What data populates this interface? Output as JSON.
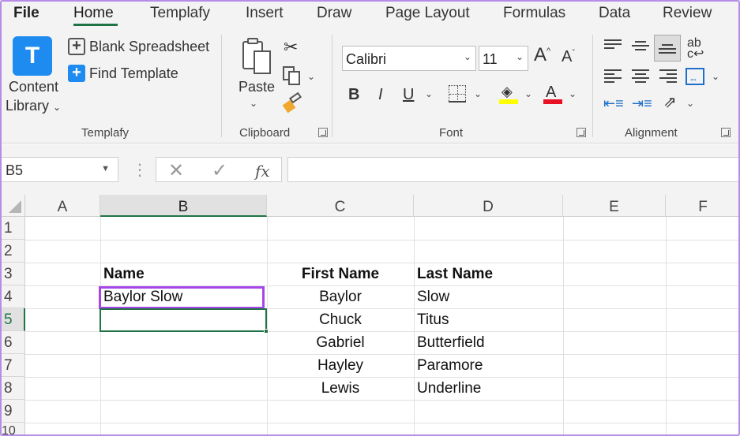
{
  "menu": {
    "tabs": [
      "File",
      "Home",
      "Templafy",
      "Insert",
      "Draw",
      "Page Layout",
      "Formulas",
      "Data",
      "Review"
    ],
    "active": "Home"
  },
  "ribbon": {
    "templafy": {
      "logo_letter": "T",
      "content_library_line1": "Content",
      "content_library_line2": "Library",
      "blank_spreadsheet": "Blank Spreadsheet",
      "find_template": "Find Template",
      "group_label": "Templafy"
    },
    "clipboard": {
      "paste": "Paste",
      "group_label": "Clipboard"
    },
    "font": {
      "font_name": "Calibri",
      "font_size": "11",
      "bold": "B",
      "italic": "I",
      "underline": "U",
      "group_label": "Font",
      "fill_color": "#ffff00",
      "font_color": "#e81123"
    },
    "alignment": {
      "group_label": "Alignment"
    }
  },
  "formula_bar": {
    "name_box": "B5",
    "fx": "fx",
    "value": ""
  },
  "sheet": {
    "columns": [
      "A",
      "B",
      "C",
      "D",
      "E",
      "F"
    ],
    "selected_column": "B",
    "rows": [
      "1",
      "2",
      "3",
      "4",
      "5",
      "6",
      "7",
      "8",
      "9",
      "10"
    ],
    "selected_row": "5",
    "cells": {
      "B3": "Name",
      "B4": "Baylor Slow",
      "C3": "First Name",
      "D3": "Last Name",
      "C4": "Baylor",
      "D4": "Slow",
      "C5": "Chuck",
      "D5": "Titus",
      "C6": "Gabriel",
      "D6": "Butterfield",
      "C7": "Hayley",
      "D7": "Paramore",
      "C8": "Lewis",
      "D8": "Underline"
    },
    "highlight_color": "#a646e8",
    "accent": "#217346"
  }
}
